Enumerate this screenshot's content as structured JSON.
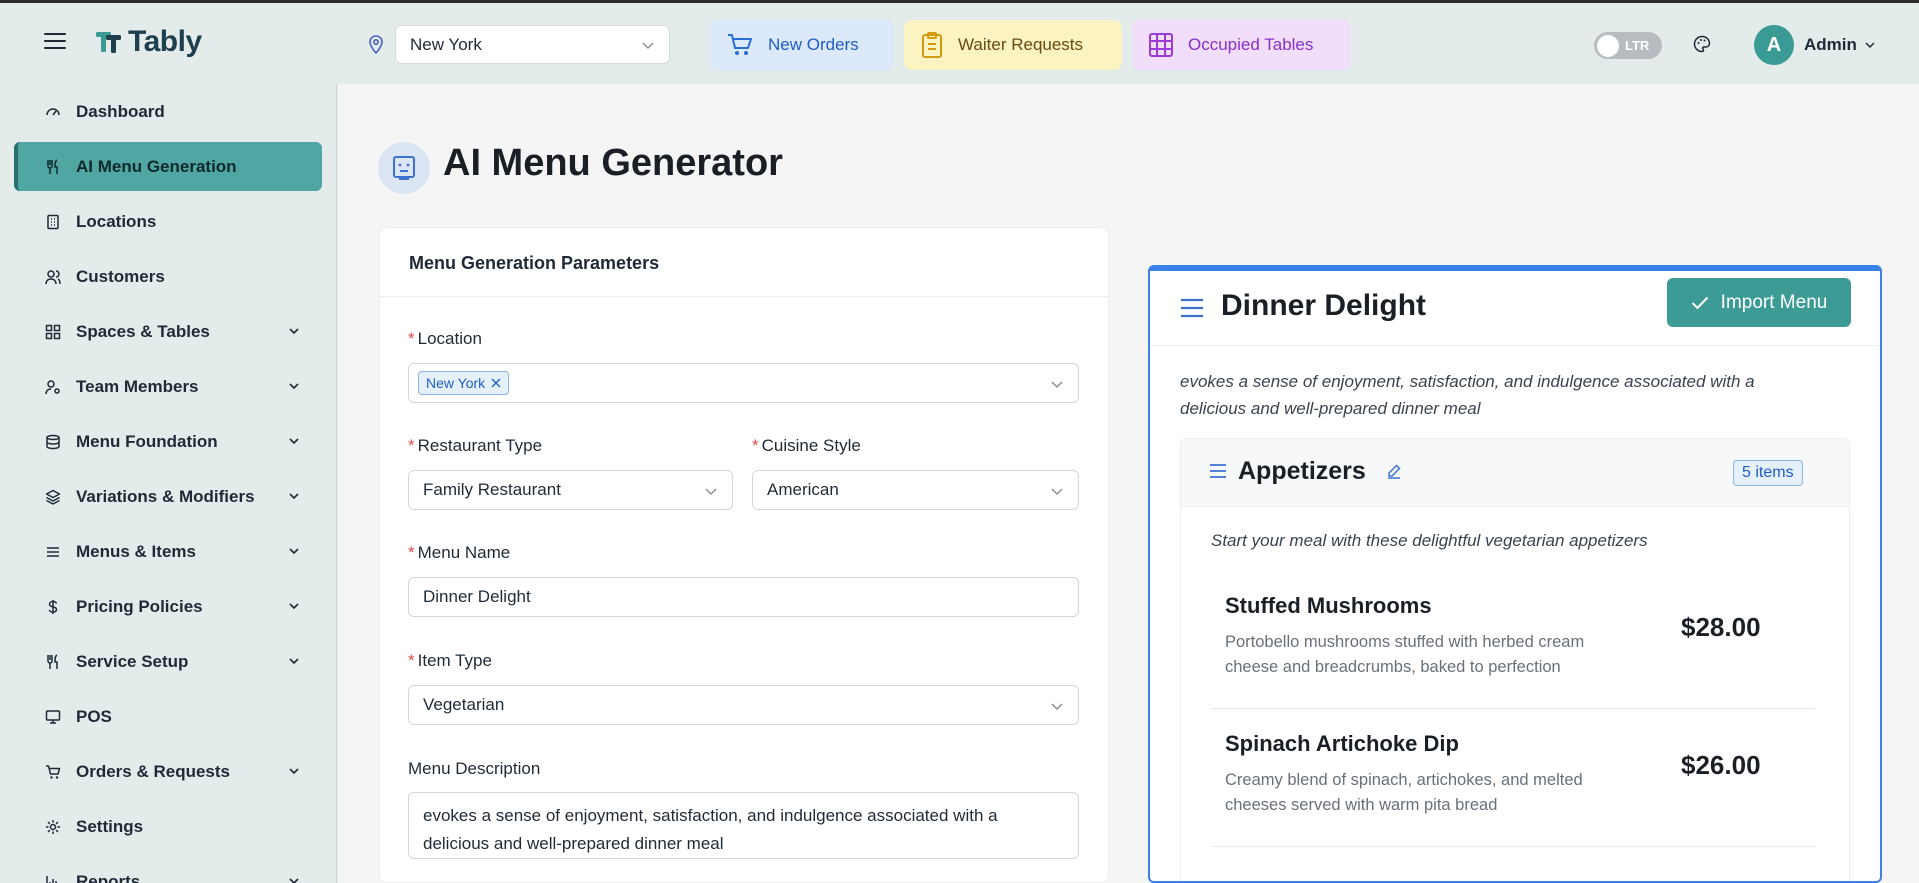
{
  "header": {
    "app_name": "Tably",
    "location": "New York",
    "quick_actions": {
      "new_orders": "New Orders",
      "waiter_requests": "Waiter Requests",
      "occupied_tables": "Occupied Tables"
    },
    "direction_toggle": "LTR",
    "user_initial": "A",
    "user_name": "Admin"
  },
  "sidebar": {
    "items": [
      {
        "label": "Dashboard"
      },
      {
        "label": "AI Menu Generation"
      },
      {
        "label": "Locations"
      },
      {
        "label": "Customers"
      },
      {
        "label": "Spaces & Tables"
      },
      {
        "label": "Team Members"
      },
      {
        "label": "Menu Foundation"
      },
      {
        "label": "Variations & Modifiers"
      },
      {
        "label": "Menus & Items"
      },
      {
        "label": "Pricing Policies"
      },
      {
        "label": "Service Setup"
      },
      {
        "label": "POS"
      },
      {
        "label": "Orders & Requests"
      },
      {
        "label": "Settings"
      },
      {
        "label": "Reports"
      }
    ]
  },
  "page": {
    "title": "AI Menu Generator"
  },
  "params": {
    "card_title": "Menu Generation Parameters",
    "location_label": "Location",
    "location_tag": "New York",
    "restaurant_type_label": "Restaurant Type",
    "restaurant_type_value": "Family Restaurant",
    "cuisine_label": "Cuisine Style",
    "cuisine_value": "American",
    "menu_name_label": "Menu Name",
    "menu_name_value": "Dinner Delight",
    "item_type_label": "Item Type",
    "item_type_value": "Vegetarian",
    "menu_desc_label": "Menu Description",
    "menu_desc_value": "evokes a sense of enjoyment, satisfaction, and indulgence associated with a delicious and well-prepared dinner meal"
  },
  "preview": {
    "title": "Dinner Delight",
    "import_label": "Import Menu",
    "description": "evokes a sense of enjoyment, satisfaction, and indulgence associated with a delicious and well-prepared dinner meal",
    "section": {
      "title": "Appetizers",
      "badge": "5 items",
      "description": "Start your meal with these delightful vegetarian appetizers",
      "items": [
        {
          "name": "Stuffed Mushrooms",
          "description": "Portobello mushrooms stuffed with herbed cream cheese and breadcrumbs, baked to perfection",
          "price": "$28.00"
        },
        {
          "name": "Spinach Artichoke Dip",
          "description": "Creamy blend of spinach, artichokes, and melted cheeses served with warm pita bread",
          "price": "$26.00"
        }
      ]
    }
  },
  "colors": {
    "accent": "#4fa6a2",
    "brand_dark": "#1e3f4d",
    "preview_border": "#3b82e6",
    "required": "#e04a4a"
  }
}
